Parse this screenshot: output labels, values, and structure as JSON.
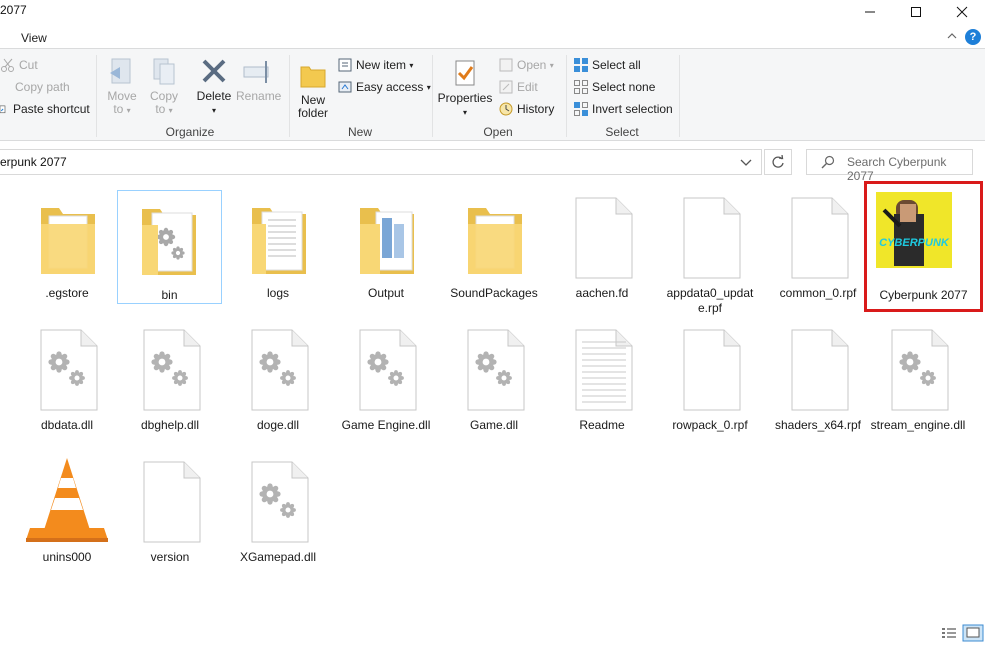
{
  "window": {
    "title": "2077"
  },
  "ribbon_tab": "View",
  "ribbon": {
    "clipboard": {
      "cut": "Cut",
      "copy_path": "Copy path",
      "paste_shortcut": "Paste shortcut"
    },
    "organize": {
      "move_to": "Move to",
      "copy_to": "Copy to",
      "delete": "Delete",
      "rename": "Rename",
      "label": "Organize"
    },
    "new": {
      "new_folder": "New folder",
      "new_item": "New item",
      "easy_access": "Easy access",
      "label": "New"
    },
    "open": {
      "properties": "Properties",
      "open": "Open",
      "edit": "Edit",
      "history": "History",
      "label": "Open"
    },
    "select": {
      "select_all": "Select all",
      "select_none": "Select none",
      "invert_selection": "Invert selection",
      "label": "Select"
    }
  },
  "address": {
    "path": "erpunk 2077",
    "search_placeholder": "Search Cyberpunk 2077"
  },
  "files": [
    {
      "name": ".egstore",
      "type": "folder"
    },
    {
      "name": "bin",
      "type": "folder-settings"
    },
    {
      "name": "logs",
      "type": "folder-doc"
    },
    {
      "name": "Output",
      "type": "folder-blue"
    },
    {
      "name": "SoundPackages",
      "type": "folder"
    },
    {
      "name": "aachen.fd",
      "type": "file"
    },
    {
      "name": "appdata0_update.rpf",
      "type": "file"
    },
    {
      "name": "common_0.rpf",
      "type": "file"
    },
    {
      "name": "Cyberpunk 2077",
      "type": "app"
    },
    {
      "name": "dbdata.dll",
      "type": "dll"
    },
    {
      "name": "dbghelp.dll",
      "type": "dll"
    },
    {
      "name": "doge.dll",
      "type": "dll"
    },
    {
      "name": "Game Engine.dll",
      "type": "dll"
    },
    {
      "name": "Game.dll",
      "type": "dll"
    },
    {
      "name": "Readme",
      "type": "text"
    },
    {
      "name": "rowpack_0.rpf",
      "type": "file"
    },
    {
      "name": "shaders_x64.rpf",
      "type": "file"
    },
    {
      "name": "stream_engine.dll",
      "type": "dll"
    },
    {
      "name": "unins000",
      "type": "vlc"
    },
    {
      "name": "version",
      "type": "file"
    },
    {
      "name": "XGamepad.dll",
      "type": "dll"
    }
  ],
  "app_icon_text": "CYBERPUNK",
  "colors": {
    "highlight": "#d91a1a",
    "selection": "#99d1ff",
    "folder": "#f8d775",
    "accent": "#1e7fd8"
  }
}
